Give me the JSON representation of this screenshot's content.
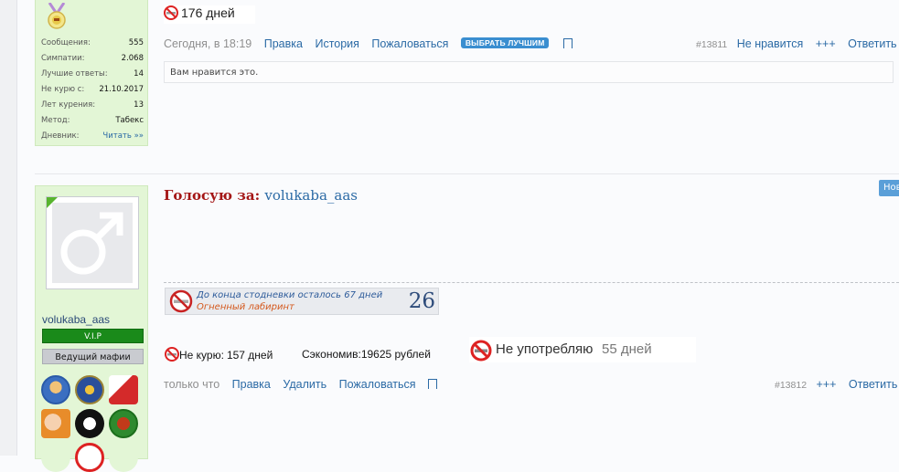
{
  "post1": {
    "days_top": "176 дней",
    "stats": [
      {
        "label": "Сообщения:",
        "value": "555"
      },
      {
        "label": "Симпатии:",
        "value": "2.068"
      },
      {
        "label": "Лучшие ответы:",
        "value": "14"
      },
      {
        "label": "Не курю с:",
        "value": "21.10.2017"
      },
      {
        "label": "Лет курения:",
        "value": "13"
      },
      {
        "label": "Метод:",
        "value": "Табекс"
      },
      {
        "label": "Дневник:",
        "value": "Читать »»"
      }
    ],
    "meta": {
      "time": "Сегодня, в 18:19",
      "edit": "Правка",
      "history": "История",
      "report": "Пожаловаться",
      "best": "ВЫБРАТЬ ЛУЧШИМ",
      "post_number": "#13811",
      "dislike": "Не нравится",
      "plus": "+++",
      "reply": "Ответить"
    },
    "likes_text": "Вам нравится это."
  },
  "post2": {
    "username": "volukaba_aas",
    "rank_vip": "V.I.P",
    "rank_mafia": "Ведущий мафии",
    "vote_label": "Голосую за:",
    "vote_name": "volukaba_aas",
    "new_badge": "Нов",
    "banner_line1": "До конца стодневки осталось 67 дней",
    "banner_line2": "Огненный лабиринт",
    "banner_number": "26",
    "no_smoke_label": "Не курю:",
    "no_smoke_value": "157 дней",
    "saved_label": "Сэкономив:",
    "saved_value": "19625 рублей",
    "drug_label": "Не употребляю",
    "drug_value": "55 дней",
    "meta": {
      "time": "только что",
      "edit": "Правка",
      "delete": "Удалить",
      "report": "Пожаловаться",
      "post_number": "#13812",
      "plus": "+++",
      "reply": "Ответить"
    }
  }
}
